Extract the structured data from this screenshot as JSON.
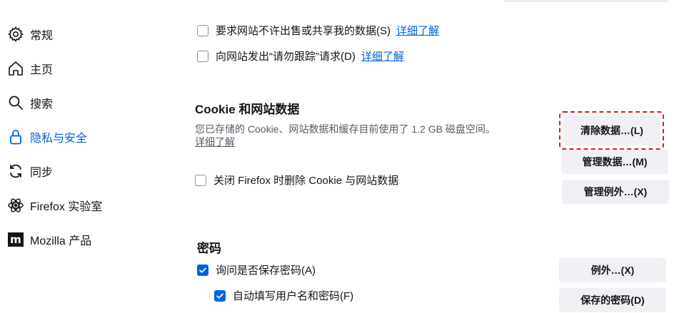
{
  "sidebar": {
    "items": [
      {
        "label": "常规",
        "icon": "gear-icon"
      },
      {
        "label": "主页",
        "icon": "home-icon"
      },
      {
        "label": "搜索",
        "icon": "search-icon"
      },
      {
        "label": "隐私与安全",
        "icon": "lock-icon",
        "active": true
      },
      {
        "label": "同步",
        "icon": "sync-icon"
      },
      {
        "label": "Firefox 实验室",
        "icon": "labs-atom-icon"
      },
      {
        "label": "Mozilla 产品",
        "icon": "mozilla-logo-icon"
      }
    ]
  },
  "privacy": {
    "gpc_label": "要求网站不许出售或共享我的数据(S)",
    "gpc_link": "详细了解",
    "dnt_label": "向网站发出“请勿跟踪”请求(D)",
    "dnt_link": "详细了解"
  },
  "cookies": {
    "title": "Cookie 和网站数据",
    "description": "您已存储的 Cookie、网站数据和缓存目前使用了 1.2 GB 磁盘空间。",
    "learn_more": "详细了解",
    "delete_on_close_label": "关闭 Firefox 时删除 Cookie 与网站数据",
    "clear_data_button": "清除数据…(L)",
    "manage_data_button": "管理数据…(M)",
    "manage_exceptions_button": "管理例外…(X)"
  },
  "passwords": {
    "title": "密码",
    "ask_to_save_label": "询问是否保存密码(A)",
    "autofill_label": "自动填写用户名和密码(F)",
    "exceptions_button": "例外…(X)",
    "saved_passwords_button": "保存的密码(D)"
  },
  "colors": {
    "accent": "#0061e0",
    "highlight": "#e0182b",
    "button_bg": "#f0f0f4"
  }
}
